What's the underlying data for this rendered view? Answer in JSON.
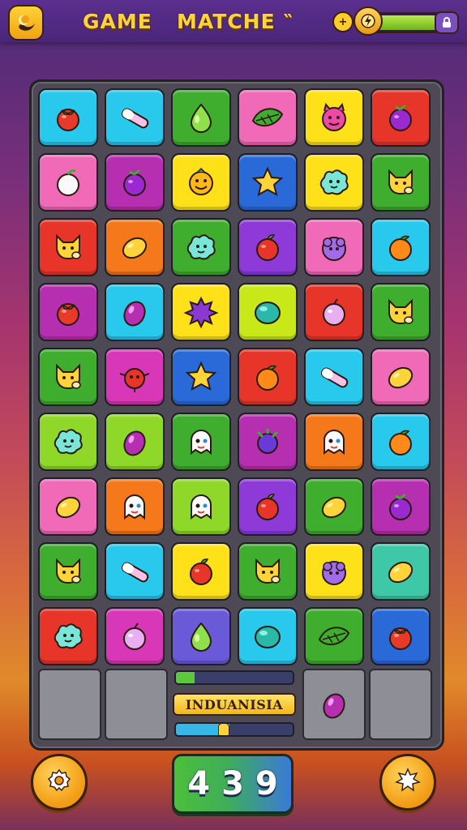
{
  "header": {
    "title_left": "GAME",
    "title_right": "MATCHE ‶"
  },
  "energy": {
    "level": 0.82,
    "badge_icon": "lock-icon"
  },
  "board": {
    "rows": [
      [
        {
          "c": "#29c9ee",
          "i": "tomato"
        },
        {
          "c": "#29c9ee",
          "i": "candy"
        },
        {
          "c": "#3fae2f",
          "i": "drop"
        },
        {
          "c": "#f06ab8",
          "i": "leaf"
        },
        {
          "c": "#ffe11a",
          "i": "devil"
        },
        {
          "c": "#e8352a",
          "i": "berry"
        }
      ],
      [
        {
          "c": "#f06ab8",
          "i": "apple-white"
        },
        {
          "c": "#b62fb0",
          "i": "berry"
        },
        {
          "c": "#ffe11a",
          "i": "smile"
        },
        {
          "c": "#2a6ad8",
          "i": "star"
        },
        {
          "c": "#ffe11a",
          "i": "blob"
        },
        {
          "c": "#3fae2f",
          "i": "fox"
        }
      ],
      [
        {
          "c": "#e8352a",
          "i": "fox"
        },
        {
          "c": "#f5781a",
          "i": "lemon"
        },
        {
          "c": "#3fae2f",
          "i": "blob"
        },
        {
          "c": "#8d3ad8",
          "i": "apple"
        },
        {
          "c": "#f06ab8",
          "i": "grape-blob"
        },
        {
          "c": "#29c9ee",
          "i": "orange"
        }
      ],
      [
        {
          "c": "#b62fb0",
          "i": "tomato"
        },
        {
          "c": "#29c9ee",
          "i": "plum"
        },
        {
          "c": "#ffe11a",
          "i": "splat"
        },
        {
          "c": "#c8e81a",
          "i": "gem"
        },
        {
          "c": "#e8352a",
          "i": "onion"
        },
        {
          "c": "#3fae2f",
          "i": "fox"
        }
      ],
      [
        {
          "c": "#3fae2f",
          "i": "fox"
        },
        {
          "c": "#d838b8",
          "i": "bomb"
        },
        {
          "c": "#2a6ad8",
          "i": "star"
        },
        {
          "c": "#e8352a",
          "i": "orange"
        },
        {
          "c": "#29c9ee",
          "i": "candy"
        },
        {
          "c": "#f06ab8",
          "i": "lemon"
        }
      ],
      [
        {
          "c": "#8fd82a",
          "i": "blob"
        },
        {
          "c": "#8fd82a",
          "i": "plum"
        },
        {
          "c": "#3fae2f",
          "i": "ghost"
        },
        {
          "c": "#b62fb0",
          "i": "eggplant"
        },
        {
          "c": "#f5781a",
          "i": "ghost"
        },
        {
          "c": "#29c9ee",
          "i": "orange"
        }
      ],
      [
        {
          "c": "#f06ab8",
          "i": "lemon"
        },
        {
          "c": "#f5781a",
          "i": "ghost"
        },
        {
          "c": "#8fd82a",
          "i": "ghost"
        },
        {
          "c": "#8d3ad8",
          "i": "apple"
        },
        {
          "c": "#3fae2f",
          "i": "lemon"
        },
        {
          "c": "#b62fb0",
          "i": "berry"
        }
      ],
      [
        {
          "c": "#3fae2f",
          "i": "fox"
        },
        {
          "c": "#29c9ee",
          "i": "candy"
        },
        {
          "c": "#ffe11a",
          "i": "apple"
        },
        {
          "c": "#3fae2f",
          "i": "fox"
        },
        {
          "c": "#ffe11a",
          "i": "grape-blob"
        },
        {
          "c": "#3fc8a8",
          "i": "lemon"
        }
      ],
      [
        {
          "c": "#e8352a",
          "i": "blob"
        },
        {
          "c": "#d838b8",
          "i": "onion"
        },
        {
          "c": "#6a5ad8",
          "i": "drop"
        },
        {
          "c": "#29c9ee",
          "i": "gem"
        },
        {
          "c": "#3fae2f",
          "i": "leaf"
        },
        {
          "c": "#2a6ad8",
          "i": "tomato"
        }
      ]
    ]
  },
  "tray": {
    "label": "INDUANISIA",
    "progress_top": 0.16,
    "progress_bottom": 0.46,
    "item": "plum"
  },
  "footer": {
    "score": "439",
    "left_button_icon": "gear-icon",
    "right_button_icon": "settings-cog-icon"
  }
}
